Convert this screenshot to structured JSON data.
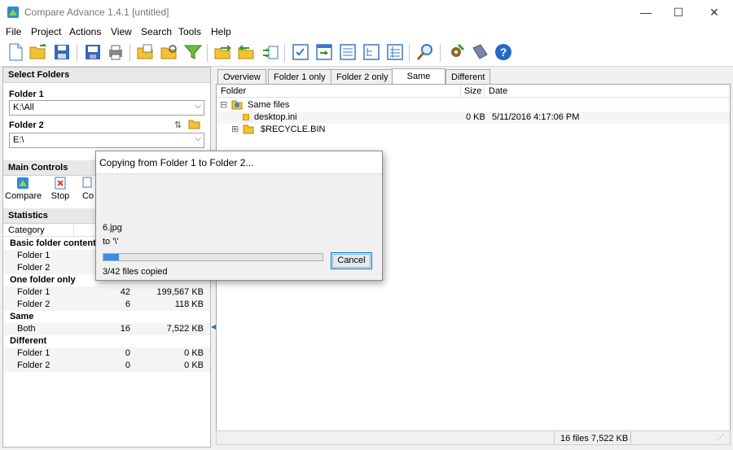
{
  "window": {
    "title": "Compare Advance 1.4.1 [untitled]",
    "minimize_glyph": "—",
    "maximize_glyph": "☐",
    "close_glyph": "✕"
  },
  "menu": [
    "File",
    "Project",
    "Actions",
    "View",
    "Search",
    "Tools",
    "Help"
  ],
  "toolbar": {
    "icons": [
      "new-file-icon",
      "open-folder-icon",
      "save-icon",
      "save-as-icon",
      "print-icon",
      "open-project-icon",
      "browse-icon",
      "filter-icon",
      "copy-right-icon",
      "copy-left-icon",
      "sync-icon",
      "checklist-icon",
      "export-icon",
      "list-icon",
      "tree-icon",
      "grid-icon",
      "search-icon",
      "tools-icon",
      "bookmark-icon",
      "help-icon"
    ]
  },
  "select_folders": {
    "heading": "Select Folders",
    "folder1_label": "Folder 1",
    "folder1_value": "K:\\All",
    "folder2_label": "Folder 2",
    "folder2_value": "E:\\",
    "swap_glyph": "⇅"
  },
  "main_controls": {
    "heading": "Main Controls",
    "compare_label": "Compare",
    "stop_label": "Stop",
    "copy_label": "Co"
  },
  "statistics": {
    "heading": "Statistics",
    "category_header": "Category",
    "rows": [
      {
        "label": "Basic folder content",
        "group": true,
        "count": "",
        "size": ""
      },
      {
        "label": "Folder 1",
        "group": false,
        "count": "",
        "size": ""
      },
      {
        "label": "Folder 2",
        "group": false,
        "count": "",
        "size": ""
      },
      {
        "label": "One folder only",
        "group": true,
        "count": "",
        "size": ""
      },
      {
        "label": "Folder 1",
        "group": false,
        "count": "42",
        "size": "199,567 KB"
      },
      {
        "label": "Folder 2",
        "group": false,
        "count": "6",
        "size": "118 KB"
      },
      {
        "label": "Same",
        "group": true,
        "count": "",
        "size": ""
      },
      {
        "label": "Both",
        "group": false,
        "count": "16",
        "size": "7,522 KB"
      },
      {
        "label": "Different",
        "group": true,
        "count": "",
        "size": ""
      },
      {
        "label": "Folder 1",
        "group": false,
        "count": "0",
        "size": "0 KB"
      },
      {
        "label": "Folder 2",
        "group": false,
        "count": "0",
        "size": "0 KB"
      }
    ]
  },
  "tabs": [
    "Overview",
    "Folder 1 only",
    "Folder 2 only",
    "Same",
    "Different"
  ],
  "active_tab": "Same",
  "list": {
    "col_folder": "Folder",
    "col_size": "Size",
    "col_date": "Date",
    "rows": [
      {
        "expander": "⊟",
        "name": "Same files",
        "size": "",
        "date": ""
      },
      {
        "expander": "",
        "name": "desktop.ini",
        "size": "0 KB",
        "date": "5/11/2016 4:17:06 PM"
      },
      {
        "expander": "⊞",
        "name": "$RECYCLE.BIN",
        "size": "",
        "date": ""
      }
    ]
  },
  "status": {
    "summary": "16 files 7,522 KB"
  },
  "dialog": {
    "title": "Copying from Folder 1 to Folder 2...",
    "file": "6.jpg",
    "to": "to  '\\'",
    "progress": 0.07,
    "cancel_label": "Cancel",
    "count_text": "3/42 files copied"
  },
  "colors": {
    "accent": "#0078d7",
    "progress": "#3a8ee6",
    "folder": "#f5c518"
  }
}
